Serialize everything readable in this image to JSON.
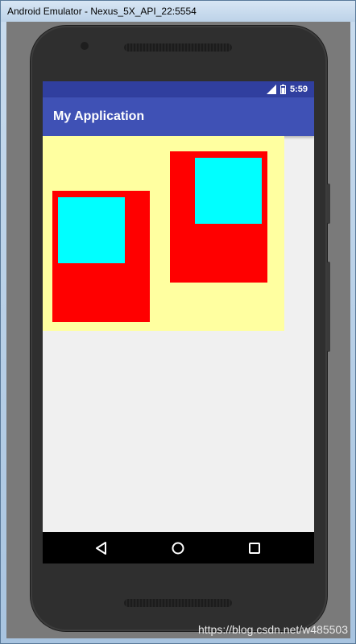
{
  "window": {
    "title": "Android Emulator - Nexus_5X_API_22:5554"
  },
  "status_bar": {
    "time": "5:59",
    "icons": [
      "signal-icon",
      "battery-icon"
    ]
  },
  "app_bar": {
    "title": "My Application"
  },
  "navigation": {
    "buttons": [
      "back-icon",
      "home-icon",
      "recents-icon"
    ]
  },
  "colors": {
    "status_bar": "#303f9f",
    "app_bar": "#3f51b5",
    "background": "#f0f0f0",
    "yellow_layout": "#ffffa0",
    "red_box": "#ff0000",
    "cyan_box": "#00ffff"
  },
  "watermark": "https://blog.csdn.net/w485503"
}
